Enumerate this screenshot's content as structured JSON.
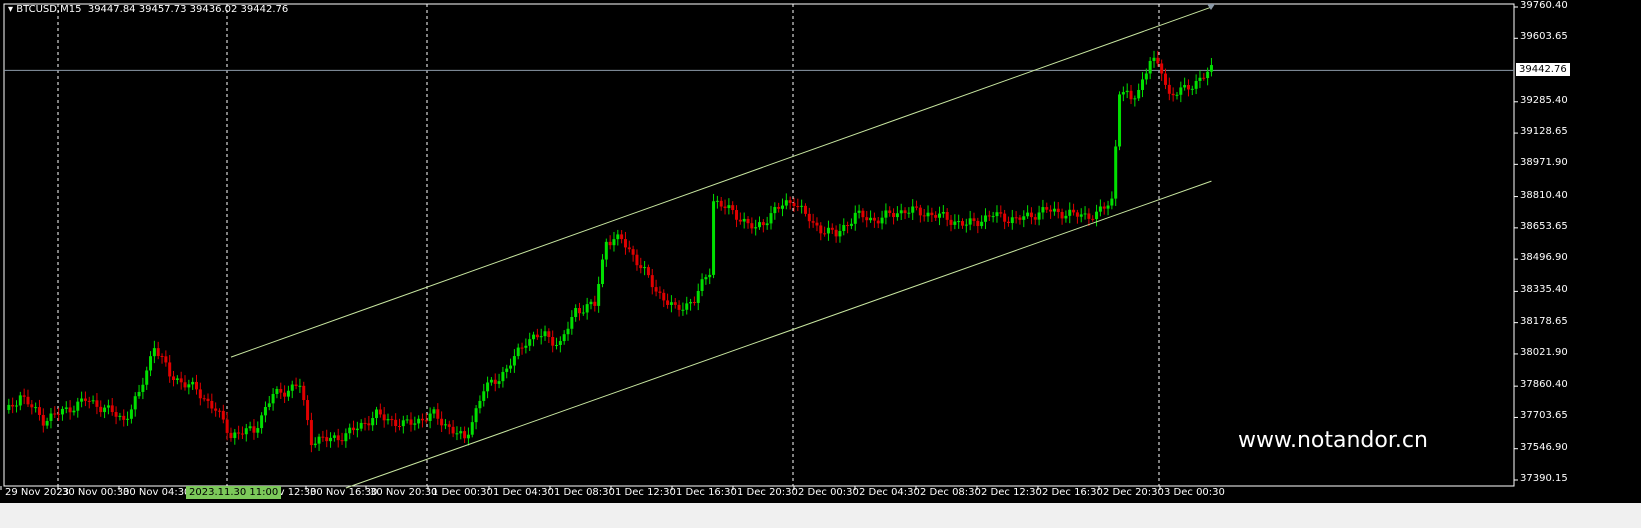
{
  "header": {
    "symbol": "BTCUSD,M15",
    "open": "39447.84",
    "high": "39457.73",
    "low": "39436.02",
    "close": "39442.76"
  },
  "watermark": "www.notandor.cn",
  "current_price_label": "39442.76",
  "crosshair_time_label": "2023.11.30 11:00",
  "colors": {
    "bull": "#00e000",
    "bear": "#e00000",
    "channel": "#c8e6a0",
    "grid": "#ffffff",
    "price_line": "#8c9aa8"
  },
  "chart_data": {
    "type": "candlestick",
    "title": "BTCUSD,M15",
    "ylim": [
      37390.15,
      39760.4
    ],
    "price_ticks": [
      "39760.40",
      "39603.65",
      "39442.76",
      "39285.40",
      "39128.65",
      "38971.90",
      "38810.40",
      "38653.65",
      "38496.90",
      "38335.40",
      "38178.65",
      "38021.90",
      "37860.40",
      "37703.65",
      "37546.90",
      "37390.15"
    ],
    "time_ticks": [
      "29 Nov 2023",
      "30 Nov 00:30",
      "30 Nov 04:30",
      "Nov 12:30",
      "30 Nov 16:30",
      "30 Nov 20:30",
      "1 Dec 00:30",
      "1 Dec 04:30",
      "1 Dec 08:30",
      "1 Dec 12:30",
      "1 Dec 16:30",
      "1 Dec 20:30",
      "2 Dec 00:30",
      "2 Dec 04:30",
      "2 Dec 08:30",
      "2 Dec 12:30",
      "2 Dec 16:30",
      "2 Dec 20:30",
      "3 Dec 00:30"
    ],
    "close_path": [
      [
        1,
        37741
      ],
      [
        4,
        37816
      ],
      [
        10,
        37691
      ],
      [
        16,
        37741
      ],
      [
        21,
        37791
      ],
      [
        26,
        37751
      ],
      [
        31,
        37691
      ],
      [
        35,
        37816
      ],
      [
        39,
        38067
      ],
      [
        43,
        37916
      ],
      [
        50,
        37841
      ],
      [
        55,
        37741
      ],
      [
        59,
        37616
      ],
      [
        65,
        37641
      ],
      [
        70,
        37816
      ],
      [
        77,
        37866
      ],
      [
        80,
        37591
      ],
      [
        84,
        37591
      ],
      [
        89,
        37616
      ],
      [
        97,
        37716
      ],
      [
        104,
        37666
      ],
      [
        112,
        37716
      ],
      [
        120,
        37591
      ],
      [
        125,
        37841
      ],
      [
        131,
        37941
      ],
      [
        136,
        38092
      ],
      [
        141,
        38117
      ],
      [
        145,
        38067
      ],
      [
        149,
        38242
      ],
      [
        154,
        38267
      ],
      [
        157,
        38593
      ],
      [
        161,
        38593
      ],
      [
        164,
        38518
      ],
      [
        170,
        38342
      ],
      [
        175,
        38242
      ],
      [
        180,
        38292
      ],
      [
        184,
        38443
      ],
      [
        185,
        38793
      ],
      [
        191,
        38718
      ],
      [
        196,
        38643
      ],
      [
        201,
        38743
      ],
      [
        206,
        38793
      ],
      [
        211,
        38668
      ],
      [
        217,
        38618
      ],
      [
        222,
        38718
      ],
      [
        227,
        38693
      ],
      [
        235,
        38743
      ],
      [
        243,
        38718
      ],
      [
        251,
        38668
      ],
      [
        258,
        38718
      ],
      [
        264,
        38693
      ],
      [
        272,
        38743
      ],
      [
        279,
        38718
      ],
      [
        285,
        38718
      ],
      [
        289,
        38793
      ],
      [
        291,
        39345
      ],
      [
        294,
        39294
      ],
      [
        296,
        39345
      ],
      [
        299,
        39495
      ],
      [
        302,
        39445
      ],
      [
        304,
        39319
      ],
      [
        308,
        39345
      ],
      [
        315,
        39443
      ]
    ],
    "channel_upper": [
      [
        59,
        38006
      ],
      [
        315,
        39760
      ]
    ],
    "channel_lower": [
      [
        89,
        37350
      ],
      [
        315,
        38888
      ]
    ],
    "current_price": 39442.76
  }
}
